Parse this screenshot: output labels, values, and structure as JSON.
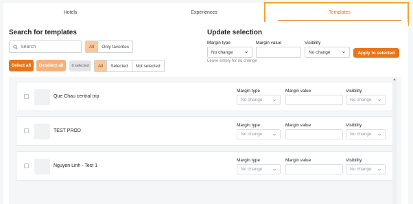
{
  "tabs": [
    {
      "label": "Hotels"
    },
    {
      "label": "Experiences"
    },
    {
      "label": "Templates"
    }
  ],
  "search_section": {
    "title": "Search for templates",
    "search_placeholder": "Search",
    "filter_options": [
      "All",
      "Only favorites"
    ],
    "select_all_label": "Select all",
    "deselect_all_label": "Deselect all",
    "selected_count": "0 selected",
    "selection_filter": [
      "All",
      "Selected",
      "Not selected"
    ]
  },
  "update_section": {
    "title": "Update selection",
    "margin_type_label": "Margin type",
    "margin_type_value": "No change",
    "margin_value_label": "Margin value",
    "margin_value_value": "",
    "visibility_label": "Visibility",
    "visibility_value": "No change",
    "apply_label": "Apply to selected",
    "hint": "Leave empty for no change"
  },
  "templates": [
    {
      "name": "Que Chau central trip",
      "margin_type_label": "Margin type",
      "margin_type": "No change",
      "margin_value_label": "Margin value",
      "visibility_label": "Visibility",
      "visibility": "No change"
    },
    {
      "name": "TEST PROD",
      "margin_type_label": "Margin type",
      "margin_type": "No change",
      "margin_value_label": "Margin value",
      "visibility_label": "Visibility",
      "visibility": "No change"
    },
    {
      "name": "Nguyen Linh - Test 1",
      "margin_type_label": "Margin type",
      "margin_type": "No change",
      "margin_value_label": "Margin value",
      "visibility_label": "Visibility",
      "visibility": "No change"
    }
  ],
  "colors": {
    "accent": "#e8751a",
    "highlight": "#f0a526",
    "active_segment": "#f9c99b"
  }
}
